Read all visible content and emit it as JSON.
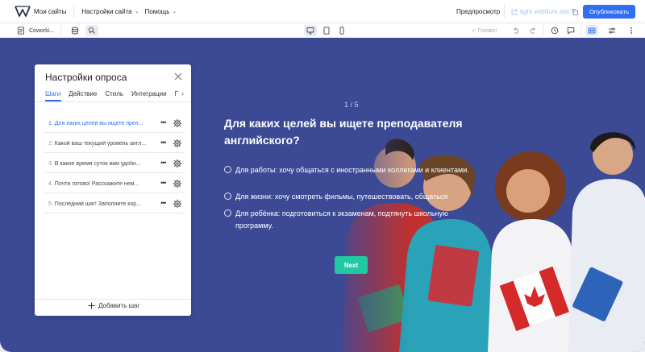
{
  "topbar": {
    "sites_label": "Мои сайты",
    "menu": [
      {
        "label": "Настройки сайта"
      },
      {
        "label": "Помощь"
      }
    ],
    "preview_label": "Предпросмотр",
    "domain": "tight.weblium.site",
    "publish_label": "Опубликовать"
  },
  "toolbar": {
    "page_name": "Coworki...",
    "status": "✓ Готово!"
  },
  "icons": [
    "logo-icon",
    "copy-icon",
    "page-icon",
    "layers-icon",
    "design-icon",
    "desktop-icon",
    "tablet-icon",
    "mobile-icon",
    "undo-icon",
    "redo-icon",
    "history-icon",
    "comment-icon",
    "panel-icon",
    "settings-sliders-icon",
    "more-icon",
    "close-icon",
    "gear-icon",
    "plus-icon",
    "chevron-right-icon"
  ],
  "colors": {
    "accent": "#2f6ef5",
    "canvas": "#3c4a96",
    "next": "#22c7a4"
  },
  "survey": {
    "step_counter": "1 / 5",
    "question": "Для каких целей вы ищете преподавателя английского?",
    "options": [
      "Для работы: хочу общаться с иностранными коллегами и клиентами.",
      "Для жизни: хочу смотреть фильмы, путешествовать, общаться",
      "Для ребёнка: подготовиться к экзаменам, подтянуть школьную программу."
    ],
    "next_label": "Next"
  },
  "panel": {
    "title": "Настройки опроса",
    "tabs": [
      "Шаги",
      "Действие",
      "Стиль",
      "Интеграции",
      "Г"
    ],
    "active_tab": "Шаги",
    "steps": [
      {
        "num": "1.",
        "label": "Для каких целей вы ищете преп..."
      },
      {
        "num": "2.",
        "label": "Какой ваш текущий уровень англ..."
      },
      {
        "num": "3.",
        "label": "В какое время суток вам удобн..."
      },
      {
        "num": "4.",
        "label": "Почти готово! Расскажите нем..."
      },
      {
        "num": "5.",
        "label": "Последний шаг! Заполните кор..."
      }
    ],
    "more_label": "•••",
    "add_step_label": "Добавить шаг"
  }
}
